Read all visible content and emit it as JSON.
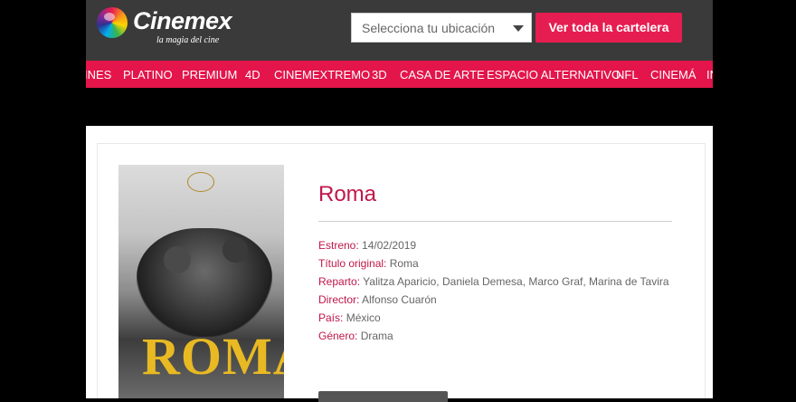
{
  "header": {
    "logo_text": "Cinemex",
    "logo_tagline": "la magia del cine",
    "location_placeholder": "Selecciona tu ubicación",
    "cartelera_button": "Ver toda la cartelera"
  },
  "nav": {
    "items": [
      "INES",
      "PLATINO",
      "PREMIUM",
      "4D",
      "CINEMEXTREMO",
      "3D",
      "CASA DE ARTE",
      "ESPACIO ALTERNATIVO",
      "NFL",
      "CINEMÁ",
      "IN"
    ]
  },
  "movie": {
    "title": "Roma",
    "poster_title": "ROMA",
    "fields": [
      {
        "label": "Estreno:",
        "value": "14/02/2019"
      },
      {
        "label": "Título original:",
        "value": "Roma"
      },
      {
        "label": "Reparto:",
        "value": "Yalitza Aparicio, Daniela Demesa, Marco Graf, Marina de Tavira"
      },
      {
        "label": "Director:",
        "value": "Alfonso Cuarón"
      },
      {
        "label": "País:",
        "value": "México"
      },
      {
        "label": "Género:",
        "value": "Drama"
      }
    ]
  },
  "colors": {
    "brand": "#e3154b",
    "accent_text": "#c0174a",
    "header_bg": "#3a3a3a"
  }
}
